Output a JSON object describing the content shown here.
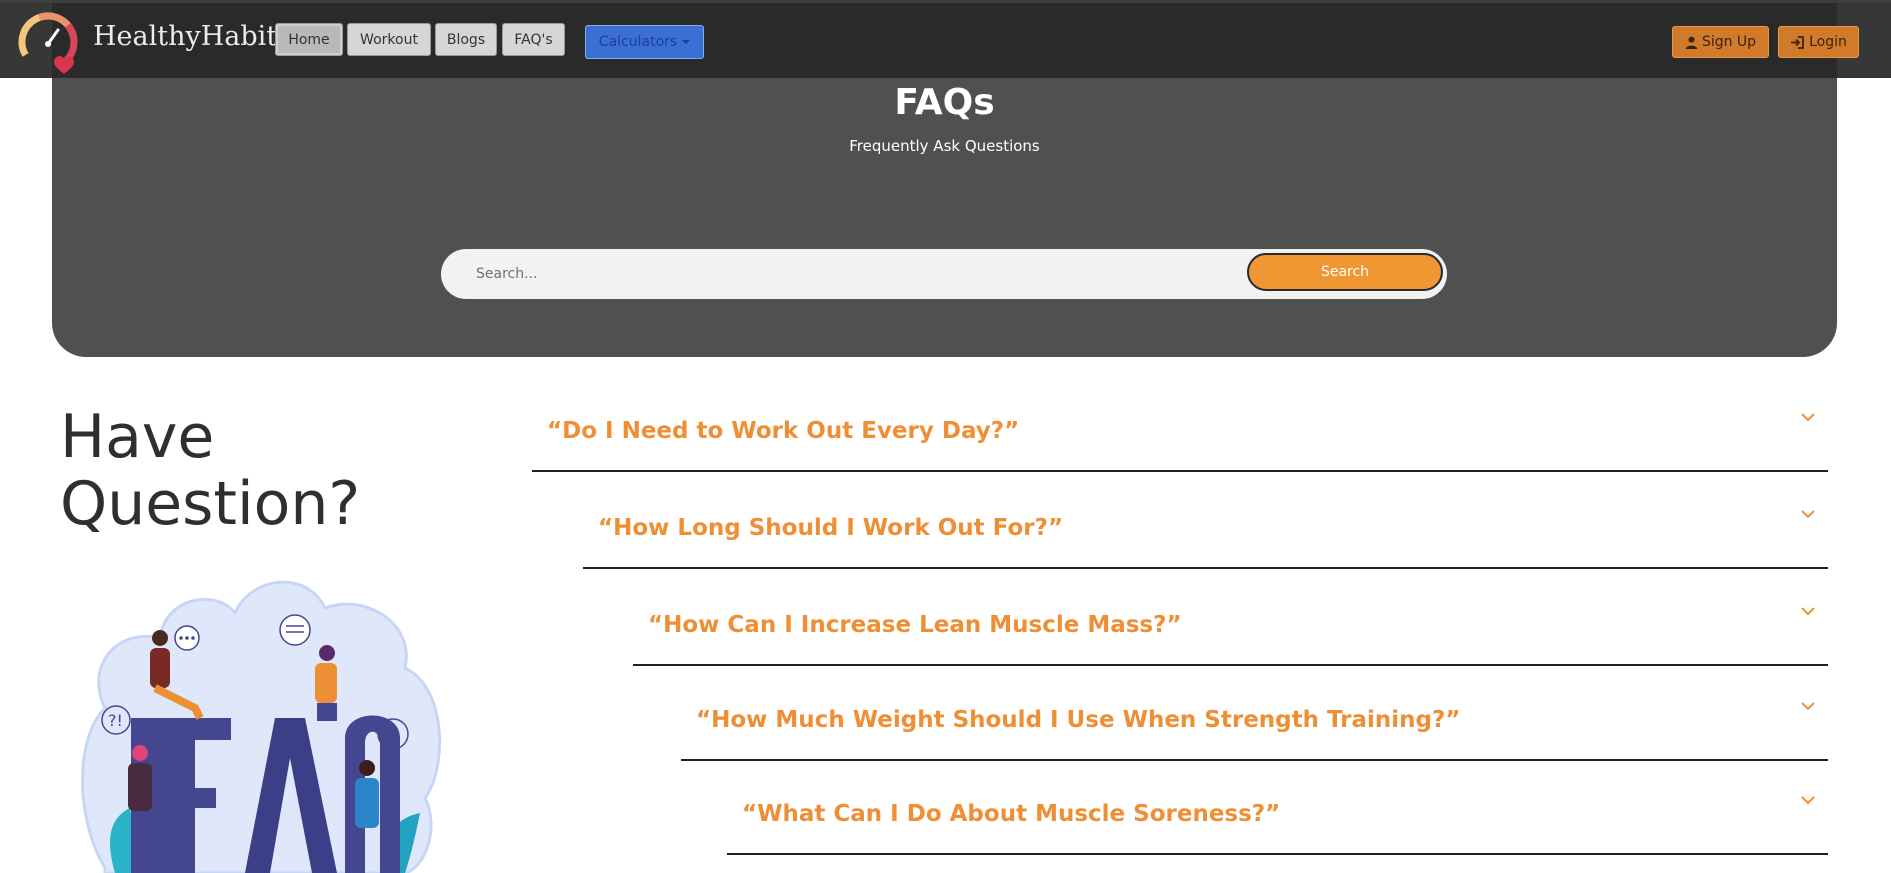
{
  "navbar": {
    "brand": "HealthyHabit",
    "links": [
      {
        "label": "Home",
        "active": true
      },
      {
        "label": "Workout",
        "active": false
      },
      {
        "label": "Blogs",
        "active": false
      },
      {
        "label": "FAQ's",
        "active": false
      }
    ],
    "calculators_label": "Calculators",
    "signup_label": "Sign Up",
    "login_label": "Login"
  },
  "hero": {
    "title": "FAQs",
    "subtitle": "Frequently Ask Questions",
    "search_placeholder": "Search...",
    "search_button": "Search"
  },
  "intro": {
    "heading_line1": "Have",
    "heading_line2": "Question?"
  },
  "faqs": [
    {
      "question": "“Do I Need to Work Out Every Day?”"
    },
    {
      "question": "“How Long Should I Work Out For?”"
    },
    {
      "question": "“How Can I Increase Lean Muscle Mass?”"
    },
    {
      "question": "“How Much Weight Should I Use When Strength Training?”"
    },
    {
      "question": "“What Can I Do About Muscle Soreness?”"
    }
  ],
  "colors": {
    "accent_orange": "#ef8f35",
    "hero_bg": "#505050",
    "navbar_bg": "#282828",
    "calc_blue": "#3a6fd6"
  },
  "illustration": {
    "big_letters": "FAQ",
    "bubble_marks": [
      "?!",
      "!!!"
    ]
  }
}
